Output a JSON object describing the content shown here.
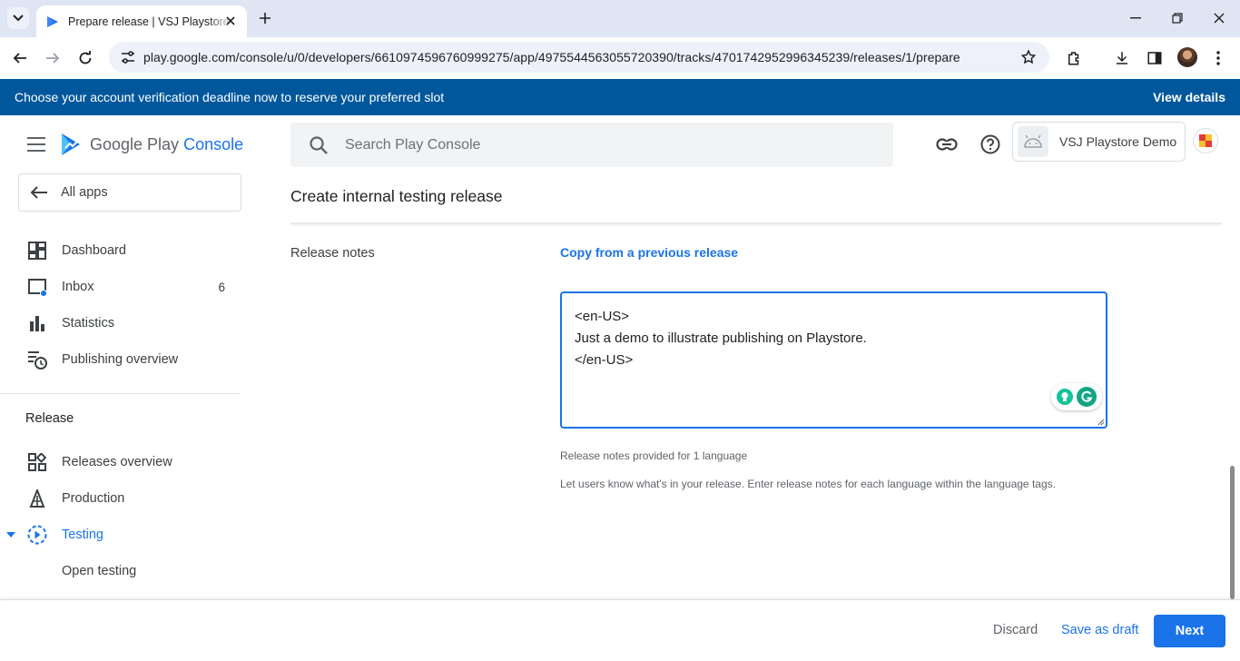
{
  "browser": {
    "tab_title": "Prepare release | VSJ Playstore Demo",
    "url": "play.google.com/console/u/0/developers/6610974596760999275/app/4975544563055720390/tracks/4701742952996345239/releases/1/prepare"
  },
  "banner": {
    "message": "Choose your account verification deadline now to reserve your preferred slot",
    "action": "View details"
  },
  "brand": {
    "google_play": "Google Play",
    "console": "Console"
  },
  "search": {
    "placeholder": "Search Play Console"
  },
  "app_selector": {
    "name": "VSJ Playstore Demo"
  },
  "sidebar": {
    "all_apps": "All apps",
    "items": [
      {
        "label": "Dashboard",
        "icon": "dashboard-icon"
      },
      {
        "label": "Inbox",
        "icon": "inbox-icon",
        "count": "6"
      },
      {
        "label": "Statistics",
        "icon": "bar-chart-icon"
      },
      {
        "label": "Publishing overview",
        "icon": "publishing-overview-icon"
      }
    ],
    "section_title": "Release",
    "release_items": [
      {
        "label": "Releases overview",
        "icon": "releases-overview-icon"
      },
      {
        "label": "Production",
        "icon": "production-icon"
      },
      {
        "label": "Testing",
        "icon": "testing-icon",
        "active": true
      },
      {
        "label": "Open testing"
      }
    ]
  },
  "main": {
    "title": "Create internal testing release",
    "release_notes_label": "Release notes",
    "copy_link": "Copy from a previous release",
    "notes_lines": [
      "<en-US>",
      "Just a demo to illustrate publishing on Playstore.",
      "</en-US>"
    ],
    "helper_count": "Release notes provided for 1 language",
    "helper_desc": "Let users know what's in your release. Enter release notes for each language within the language tags."
  },
  "footer": {
    "discard": "Discard",
    "save_draft": "Save as draft",
    "next": "Next"
  },
  "colors": {
    "accent": "#1a73e8",
    "banner": "#01579b"
  }
}
